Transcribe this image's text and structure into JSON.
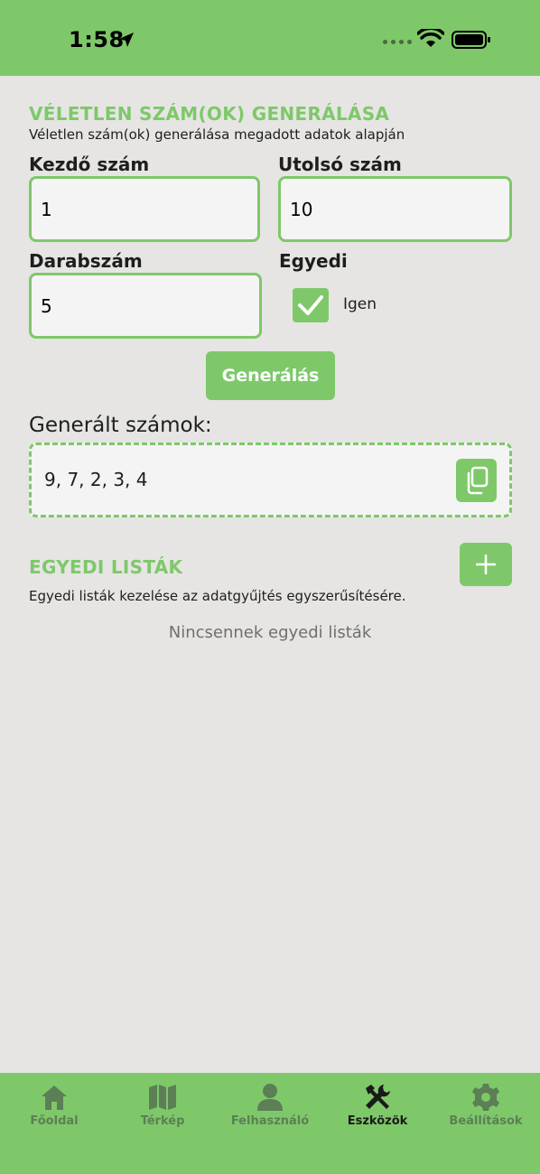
{
  "status_bar": {
    "time": "1:58",
    "background_color": "#7ec86a"
  },
  "random_section": {
    "title": "VÉLETLEN SZÁM(OK) GENERÁLÁSA",
    "description": "Véletlen szám(ok) generálása megadott adatok alapján",
    "start_label": "Kezdő szám",
    "start_value": "1",
    "end_label": "Utolsó szám",
    "end_value": "10",
    "count_label": "Darabszám",
    "count_value": "5",
    "unique_label": "Egyedi",
    "unique_checked": true,
    "unique_option_label": "Igen",
    "generate_button": "Generálás",
    "result_label": "Generált számok:",
    "result_value": "9, 7, 2, 3, 4",
    "copy_icon": "copy-icon"
  },
  "custom_lists": {
    "title": "EGYEDI LISTÁK",
    "description": "Egyedi listák kezelése az adatgyűjtés egyszerűsítésére.",
    "empty_text": "Nincsennek egyedi listák",
    "add_icon": "plus-icon"
  },
  "tab_bar": {
    "items": [
      {
        "label": "Főoldal",
        "icon": "home-icon",
        "active": false
      },
      {
        "label": "Térkép",
        "icon": "map-icon",
        "active": false
      },
      {
        "label": "Felhasználó",
        "icon": "user-icon",
        "active": false
      },
      {
        "label": "Eszközök",
        "icon": "tools-icon",
        "active": true
      },
      {
        "label": "Beállítások",
        "icon": "gear-icon",
        "active": false
      }
    ]
  },
  "colors": {
    "accent": "#7ec86a",
    "background": "#e6e5e3",
    "field_background": "#f4f4f4",
    "tab_inactive": "#5c7f55"
  }
}
